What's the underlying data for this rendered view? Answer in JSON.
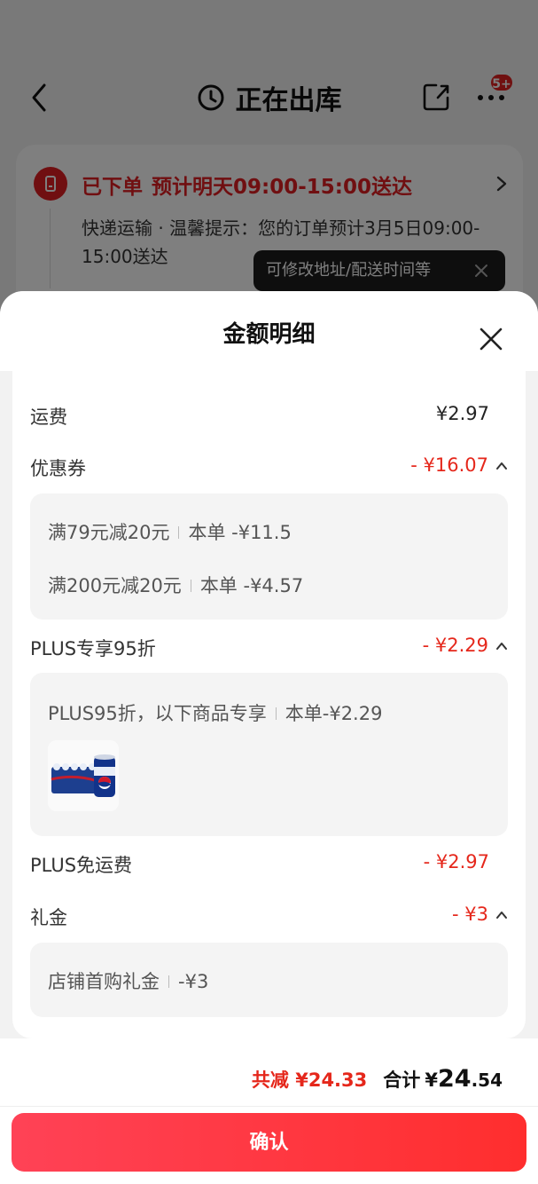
{
  "header": {
    "title": "正在出库",
    "more_badge": "5+"
  },
  "order_card": {
    "status": "已下单",
    "eta": "预计明天09:00-15:00送达",
    "description": "快递运输 · 温馨提示：您的订单预计3月5日09:00-15:00送达"
  },
  "tooltip": {
    "text": "可修改地址/配送时间等"
  },
  "sheet": {
    "title": "金额明细",
    "rows": {
      "shipping": {
        "label": "运费",
        "value": "¥2.97"
      },
      "coupon": {
        "label": "优惠券",
        "value": "- ¥16.07",
        "items": [
          {
            "name": "满79元减20元",
            "detail": "本单 -¥11.5"
          },
          {
            "name": "满200元减20元",
            "detail": "本单 -¥4.57"
          }
        ]
      },
      "plus_discount": {
        "label": "PLUS专享95折",
        "value": "- ¥2.29",
        "item": {
          "name": "PLUS95折，以下商品专享",
          "detail": "本单-¥2.29"
        },
        "product_thumb": "pepsi-can-pack"
      },
      "plus_free_shipping": {
        "label": "PLUS免运费",
        "value": "- ¥2.97"
      },
      "gift": {
        "label": "礼金",
        "value": "- ¥3",
        "item": {
          "name": "店铺首购礼金",
          "detail": "-¥3"
        }
      }
    }
  },
  "footer": {
    "reduce_text": "共减 ¥24.33",
    "total_label": "合计",
    "total_currency": "¥",
    "total_int": "24",
    "total_dec": ".54",
    "confirm_label": "确认"
  },
  "colors": {
    "accent_red": "#e5271b",
    "button_gradient_start": "#ff4256",
    "button_gradient_end": "#ff2e2e"
  }
}
